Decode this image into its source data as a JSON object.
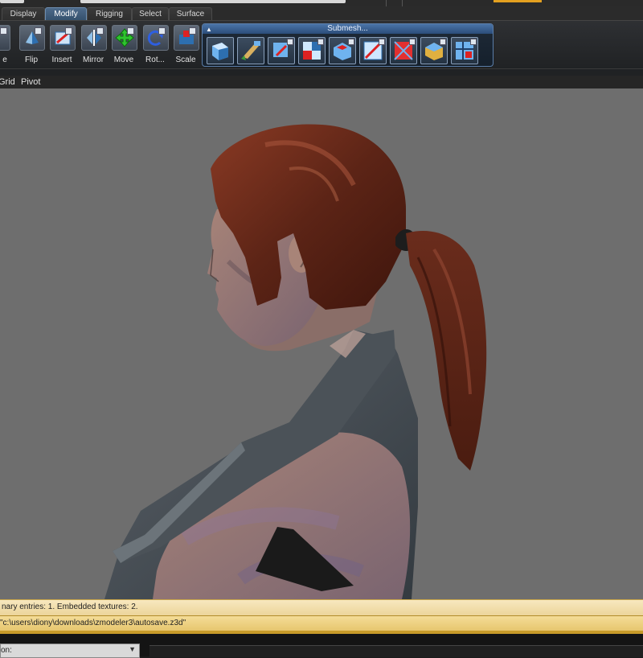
{
  "tabs": [
    {
      "label": "Display",
      "active": false
    },
    {
      "label": "Modify",
      "active": true
    },
    {
      "label": "Rigging",
      "active": false
    },
    {
      "label": "Select",
      "active": false
    },
    {
      "label": "Surface",
      "active": false
    }
  ],
  "ribbon": {
    "first_tool_label": "e",
    "tools": [
      {
        "label": "Flip",
        "icon": "flip-icon"
      },
      {
        "label": "Insert",
        "icon": "insert-icon"
      },
      {
        "label": "Mirror",
        "icon": "mirror-icon"
      },
      {
        "label": "Move",
        "icon": "move-icon"
      },
      {
        "label": "Rot...",
        "icon": "rotate-icon"
      },
      {
        "label": "Scale",
        "icon": "scale-icon"
      }
    ],
    "submesh_title": "Submesh..."
  },
  "menubar": {
    "items": [
      "Grid",
      "Pivot"
    ]
  },
  "status": {
    "line1": "nary entries: 1. Embedded textures: 2.",
    "line2": "\"c:\\users\\diony\\downloads\\zmodeler3\\autosave.z3d\""
  },
  "bottom": {
    "dropdown_value": "on:"
  },
  "colors": {
    "viewport_bg": "#6e6e6e",
    "hair": "#6a2c1c",
    "skin": "#9a7a70",
    "shirt": "#4b5258",
    "status_bg": "#ecd59a",
    "active_tab": "#35516e"
  }
}
